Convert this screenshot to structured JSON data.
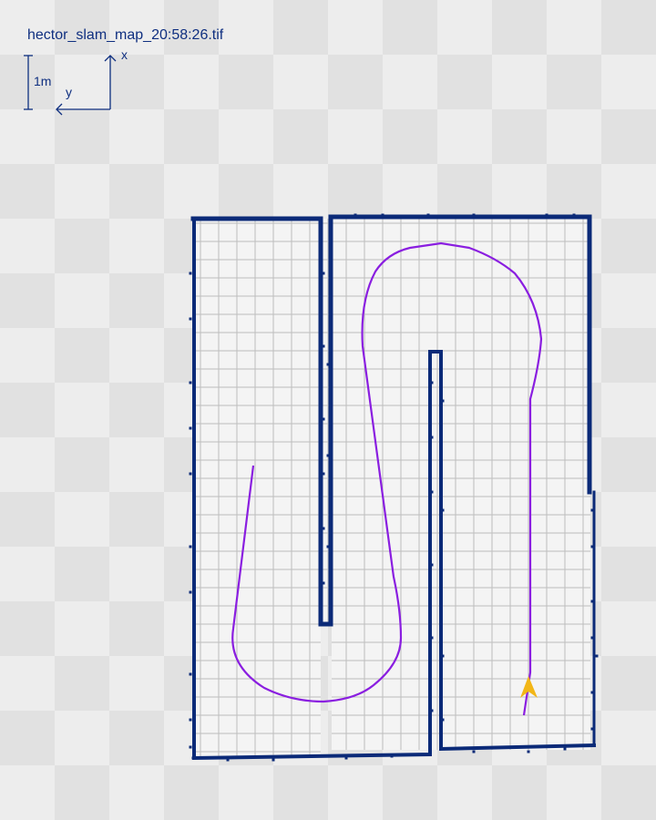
{
  "map": {
    "title": "hector_slam_map_20:58:26.tif",
    "scale_label": "1m",
    "axis_x_label": "x",
    "axis_y_label": "y"
  },
  "colors": {
    "wall": "#0b2a78",
    "grid": "#bdbdbd",
    "free_space": "#f4f4f4",
    "checker_light": "#ededed",
    "checker_dark": "#e1e1e1",
    "path": "#8a1ee0",
    "robot_marker": "#f2b617"
  },
  "robot": {
    "icon": "arrow-marker-icon"
  }
}
